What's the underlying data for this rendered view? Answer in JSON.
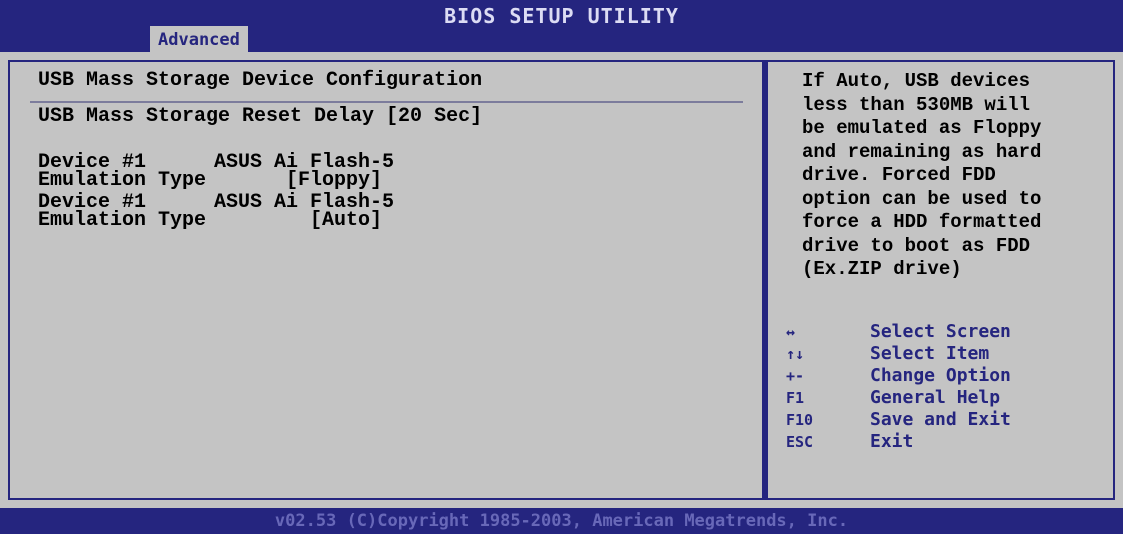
{
  "header": {
    "title": "BIOS SETUP UTILITY",
    "tab_label": "Advanced"
  },
  "main": {
    "section_title": "USB Mass Storage Device Configuration",
    "reset_delay": "USB Mass Storage Reset Delay [20 Sec]",
    "devices": [
      {
        "label": "Device #1",
        "name": "ASUS Ai Flash-5",
        "emulation_label": "Emulation Type",
        "emulation_value": "[Floppy]"
      },
      {
        "label": "Device #1",
        "name": "ASUS Ai Flash-5",
        "emulation_label": "Emulation Type",
        "emulation_value": "[Auto]"
      }
    ]
  },
  "help": {
    "text": "If Auto, USB devices\nless than 530MB will\nbe emulated as Floppy\nand remaining as hard\ndrive. Forced FDD\noption can be used to\nforce a HDD formatted\ndrive to boot as FDD\n(Ex.ZIP drive)"
  },
  "keys": [
    {
      "key": "↔",
      "desc": "Select Screen"
    },
    {
      "key": "↑↓",
      "desc": "Select Item"
    },
    {
      "key": "+-",
      "desc": "Change Option"
    },
    {
      "key": "F1",
      "desc": "General Help"
    },
    {
      "key": "F10",
      "desc": "Save and Exit"
    },
    {
      "key": "ESC",
      "desc": "Exit"
    }
  ],
  "footer": "v02.53 (C)Copyright 1985-2003, American Megatrends, Inc.",
  "colors": {
    "background": "#c4c4c4",
    "accent": "#25257f"
  }
}
